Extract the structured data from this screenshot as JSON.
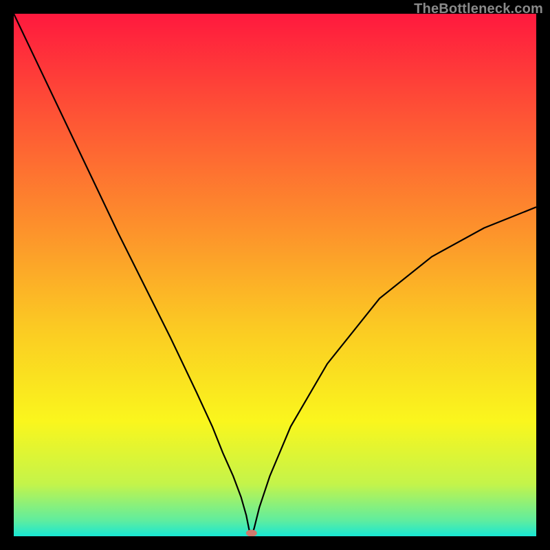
{
  "watermark": "TheBottleneck.com",
  "chart_data": {
    "type": "line",
    "title": "",
    "xlabel": "",
    "ylabel": "",
    "xlim": [
      0,
      100
    ],
    "ylim": [
      0,
      100
    ],
    "grid": false,
    "legend": false,
    "background_gradient": {
      "orientation": "vertical",
      "stops": [
        {
          "pos": 0.0,
          "color": "#ff193e"
        },
        {
          "pos": 0.2,
          "color": "#fe5535"
        },
        {
          "pos": 0.4,
          "color": "#fd8e2c"
        },
        {
          "pos": 0.6,
          "color": "#fbca23"
        },
        {
          "pos": 0.78,
          "color": "#faf61d"
        },
        {
          "pos": 0.9,
          "color": "#c4f44a"
        },
        {
          "pos": 0.97,
          "color": "#5fed9f"
        },
        {
          "pos": 1.0,
          "color": "#18e7d4"
        }
      ]
    },
    "series": [
      {
        "name": "bottleneck-curve",
        "color": "#000000",
        "x": [
          0,
          5,
          10,
          15,
          20,
          25,
          30,
          35,
          38,
          40,
          42,
          43.5,
          44.5,
          45,
          45.3,
          45.5,
          46,
          47,
          49,
          53,
          60,
          70,
          80,
          90,
          100
        ],
        "y": [
          100,
          89.5,
          79,
          68.5,
          58,
          48,
          38,
          27.5,
          21,
          16,
          11.5,
          7.5,
          4,
          1.5,
          0.2,
          0,
          1.5,
          5.5,
          11.5,
          21,
          33,
          45.5,
          53.5,
          59,
          63
        ]
      }
    ],
    "markers": [
      {
        "name": "min-marker",
        "x": 45.5,
        "y": 0.6,
        "color": "#cf7a6e",
        "rx": 8,
        "ry": 5
      }
    ]
  }
}
